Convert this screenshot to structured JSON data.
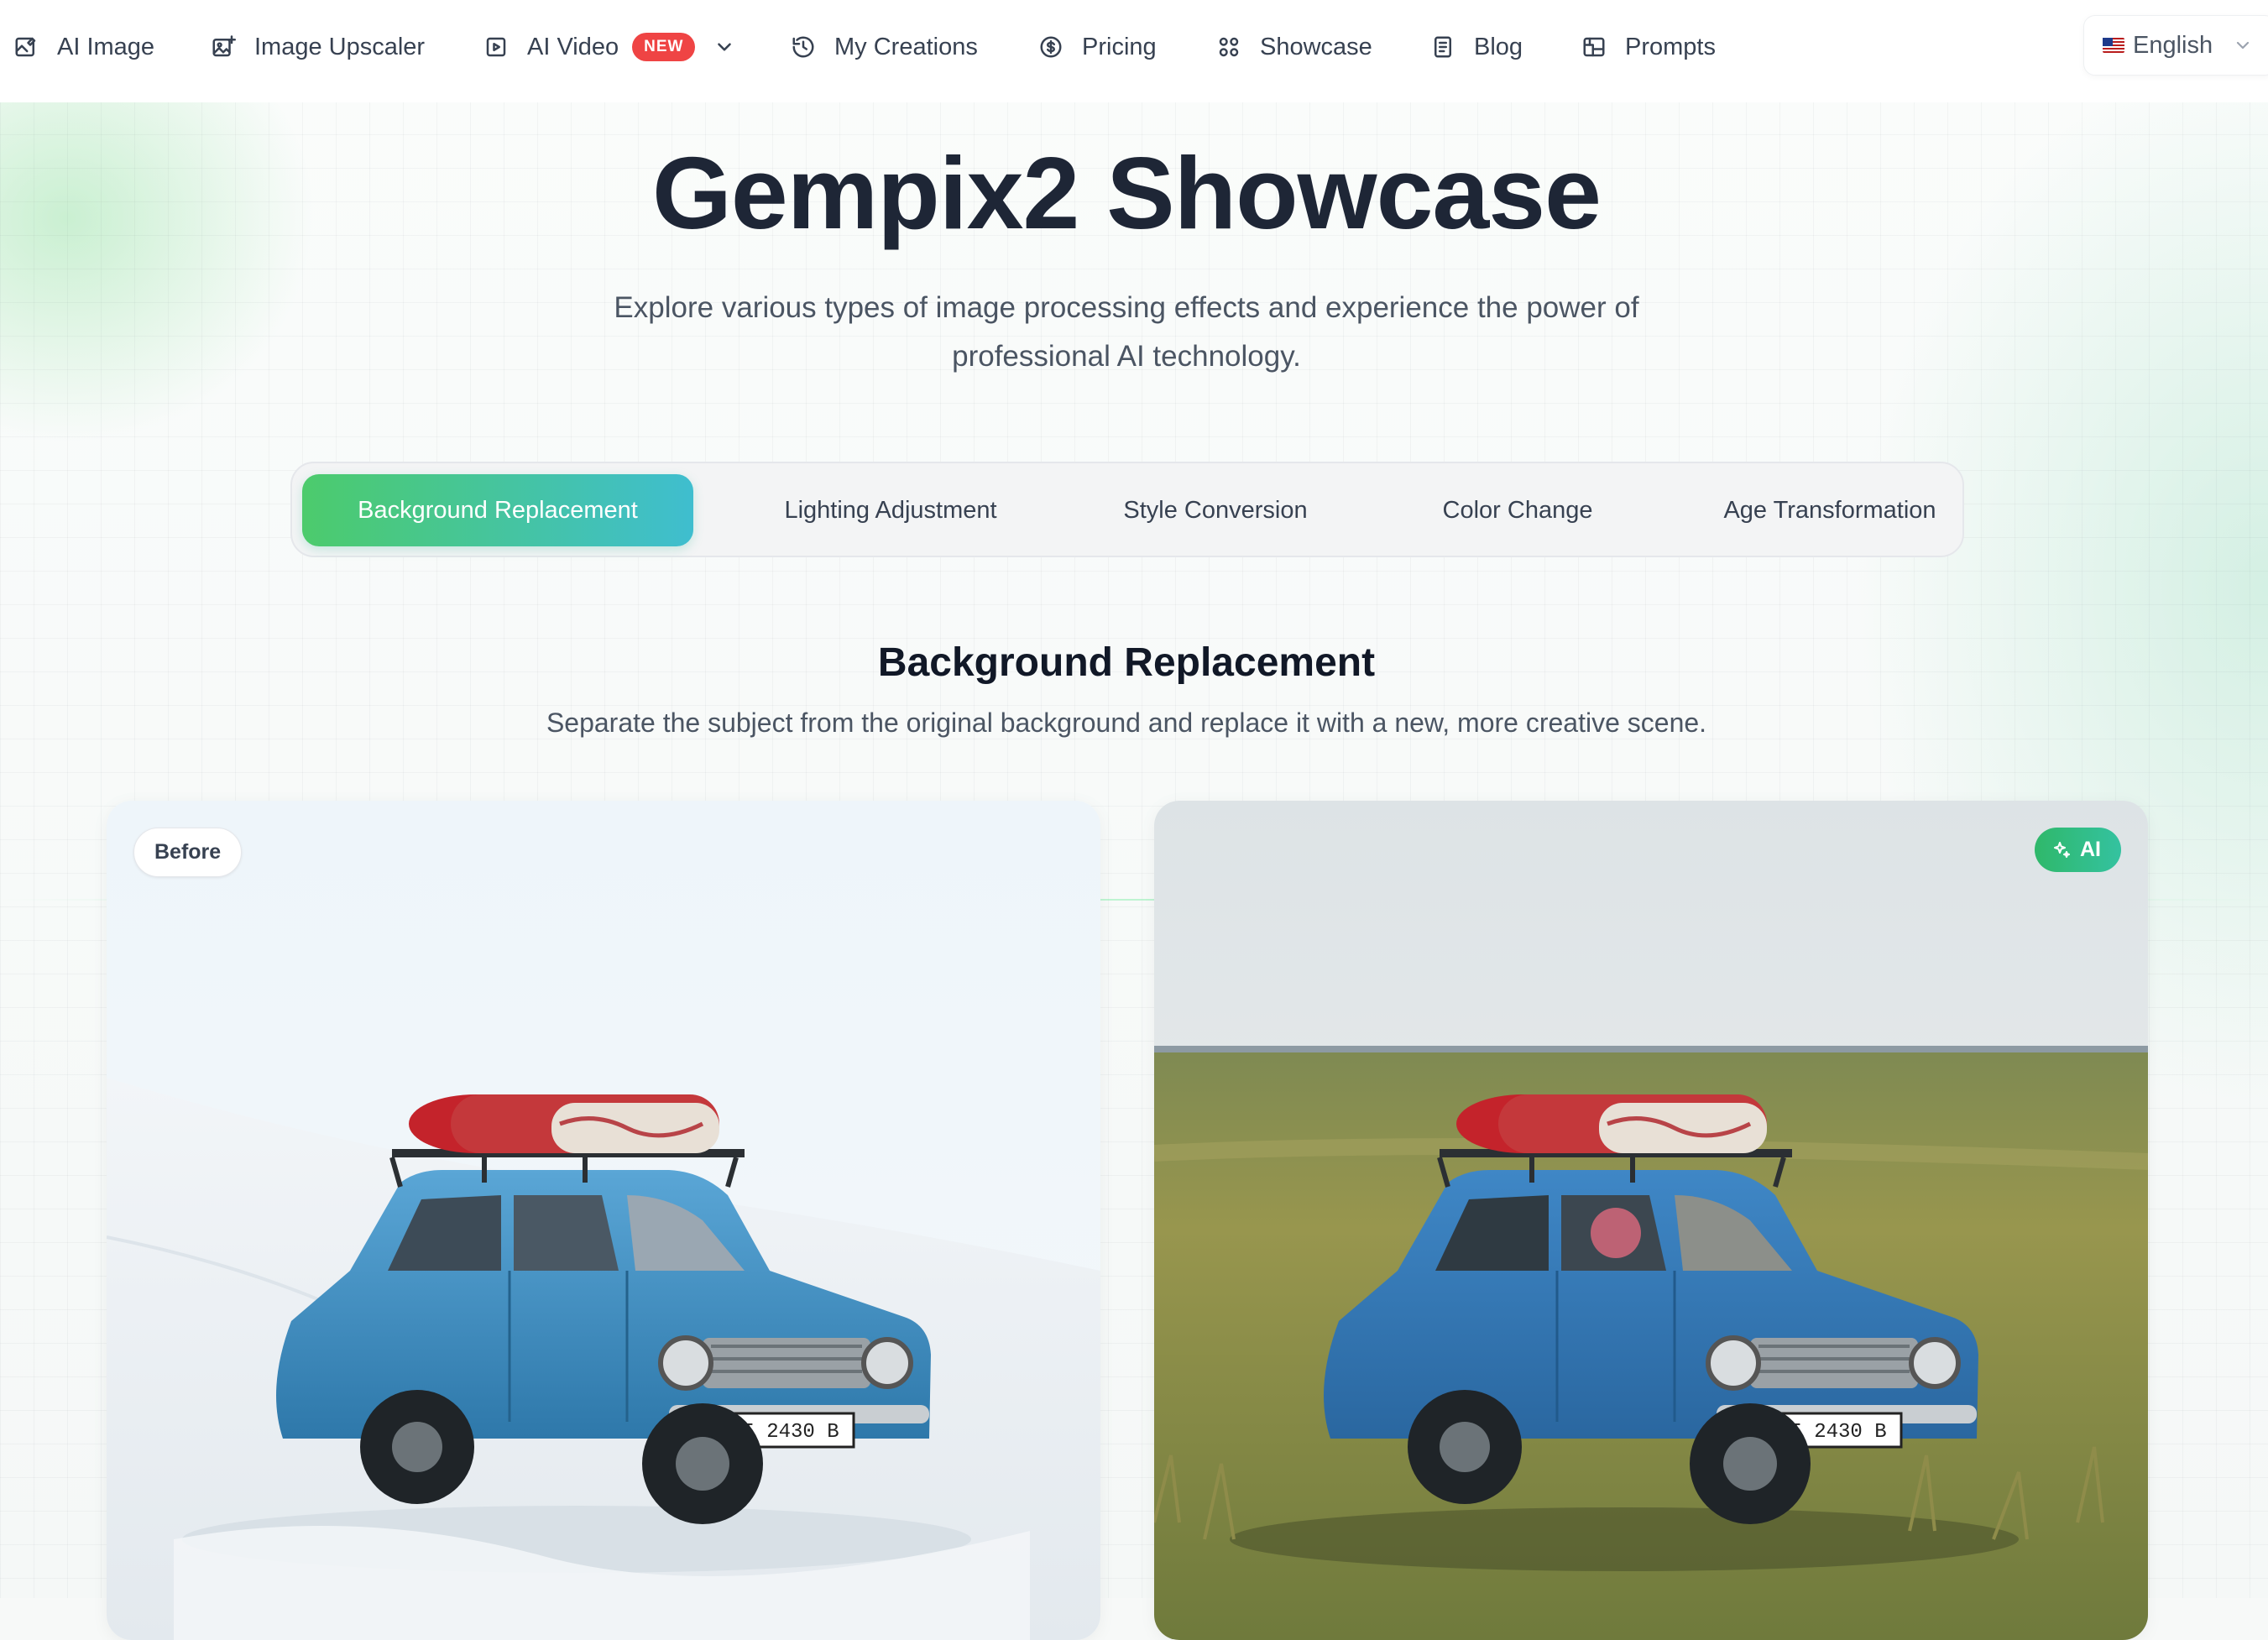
{
  "nav": {
    "items": [
      {
        "label": "AI Image",
        "icon": "image-edit-icon"
      },
      {
        "label": "Image Upscaler",
        "icon": "image-plus-icon"
      },
      {
        "label": "AI Video",
        "icon": "play-square-icon",
        "badge": "NEW"
      },
      {
        "label": "My Creations",
        "icon": "history-icon"
      },
      {
        "label": "Pricing",
        "icon": "dollar-circle-icon"
      },
      {
        "label": "Showcase",
        "icon": "grid-circles-icon"
      },
      {
        "label": "Blog",
        "icon": "document-icon"
      },
      {
        "label": "Prompts",
        "icon": "gallery-icon"
      }
    ],
    "language": "English"
  },
  "hero": {
    "title": "Gempix2 Showcase",
    "subtitle_line1": "Explore various types of image processing effects and experience the power of",
    "subtitle_line2": "professional AI technology."
  },
  "tabs": [
    {
      "label": "Background Replacement",
      "active": true
    },
    {
      "label": "Lighting Adjustment",
      "active": false
    },
    {
      "label": "Style Conversion",
      "active": false
    },
    {
      "label": "Color Change",
      "active": false
    },
    {
      "label": "Age Transformation",
      "active": false
    }
  ],
  "section": {
    "title": "Background Replacement",
    "description": "Separate the subject from the original background and replace it with a new, more creative scene."
  },
  "comparison": {
    "before_label": "Before",
    "after_label": "AI",
    "plate_text": "I 2430 B"
  },
  "colors": {
    "tab_gradient_start": "#4ccb6c",
    "tab_gradient_end": "#3fbecf",
    "new_badge": "#ef4444",
    "ai_badge": "#2fb86a",
    "car_blue": "#3d8fc4"
  }
}
